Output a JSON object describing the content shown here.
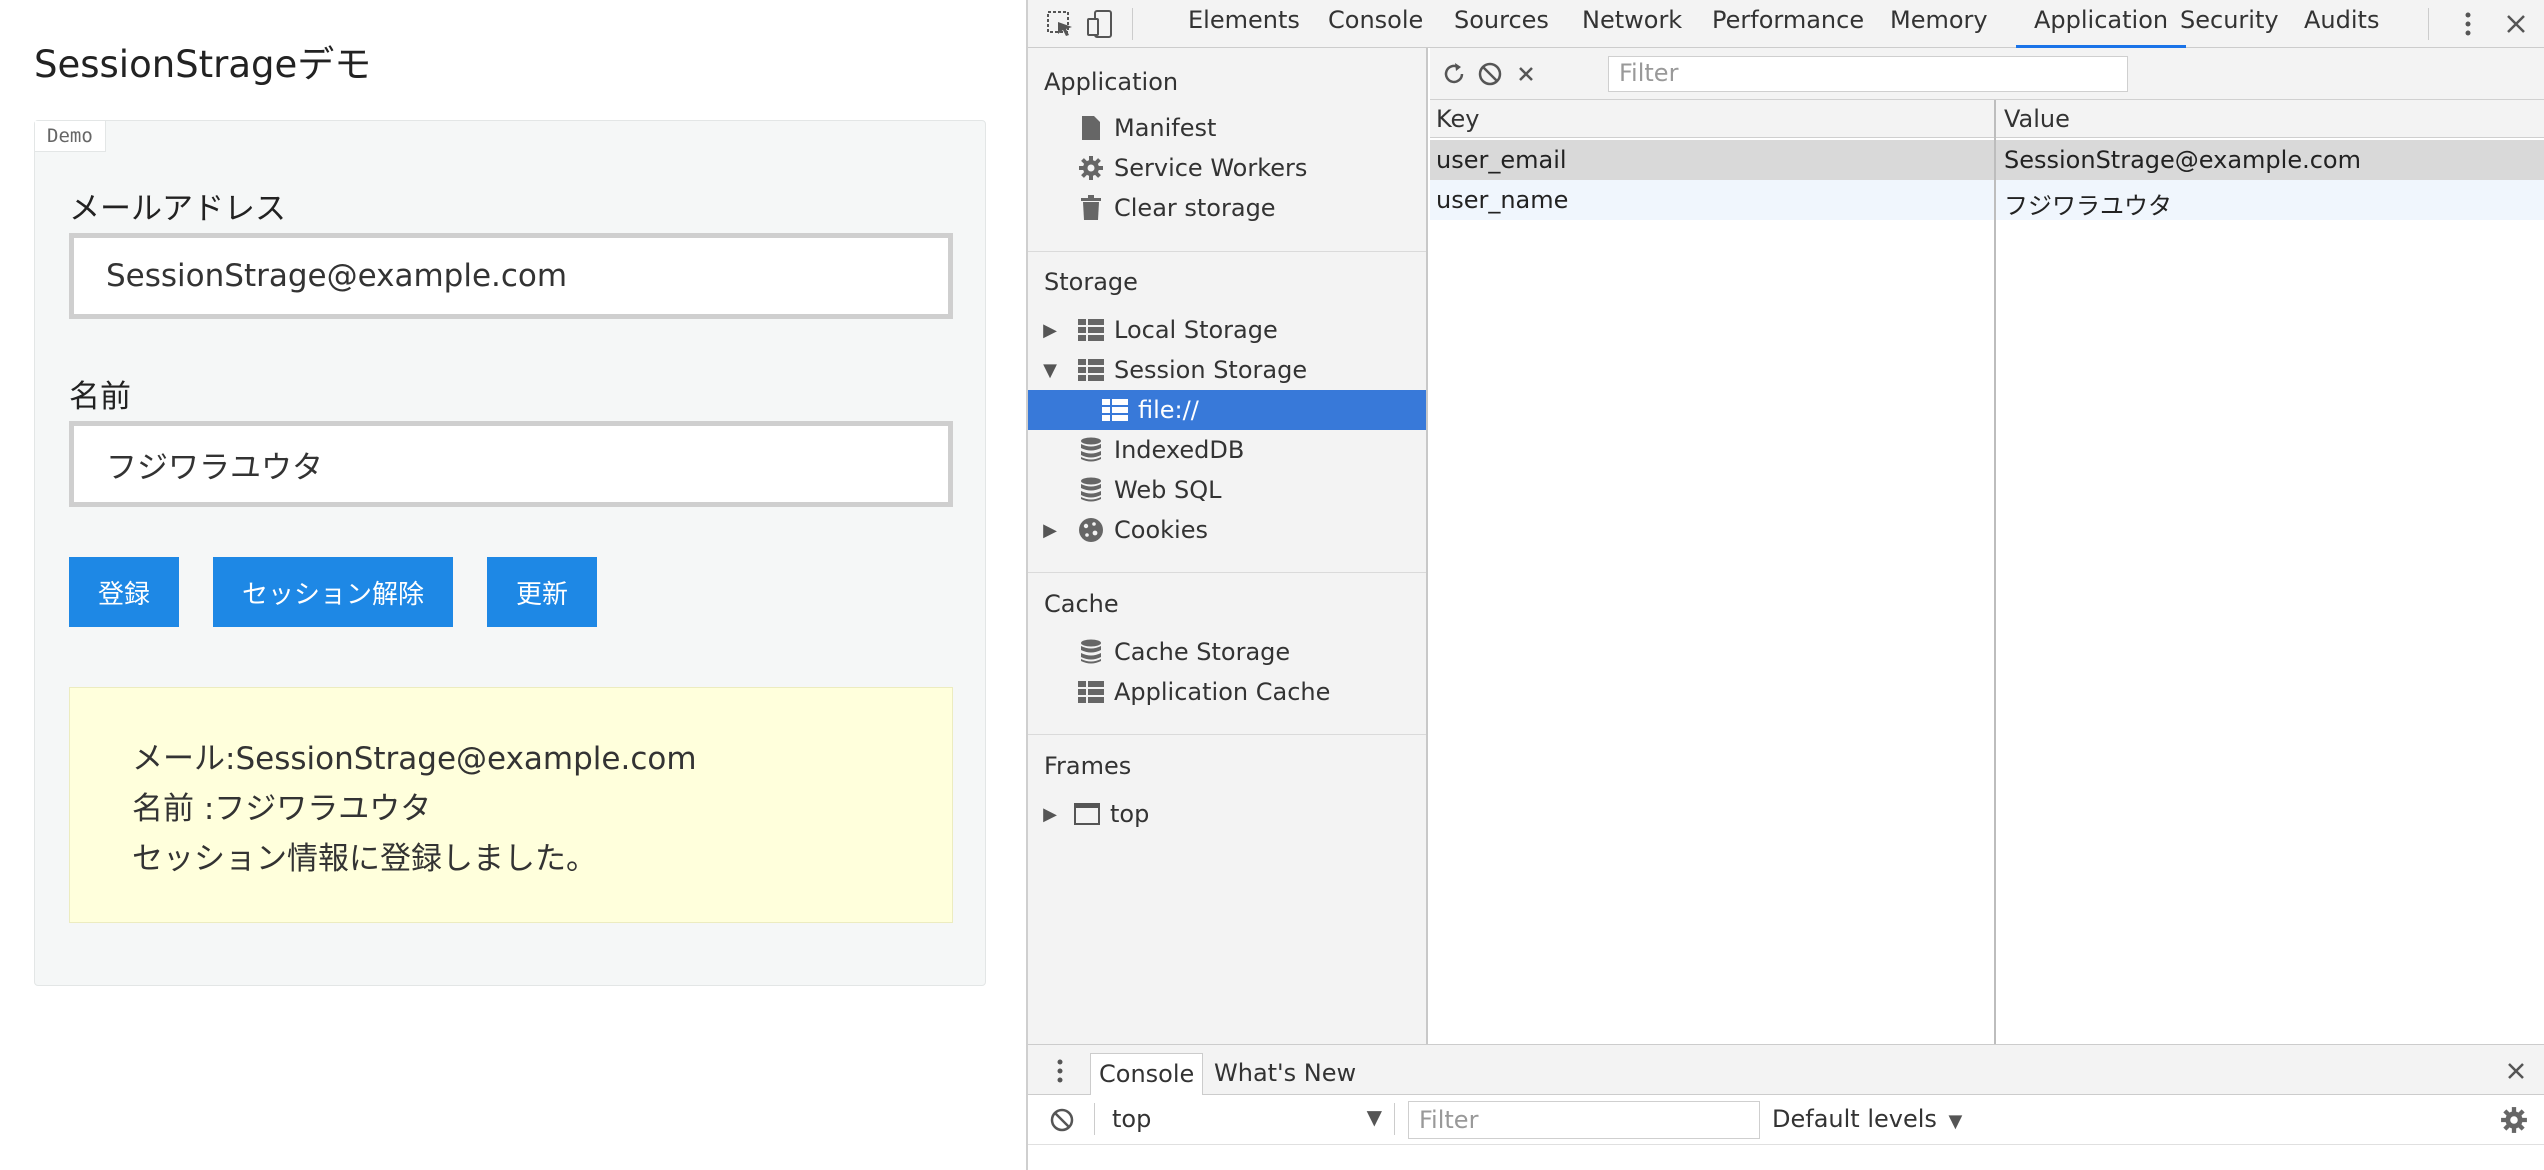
{
  "page": {
    "title": "SessionStrageデモ",
    "demo_tag": "Demo",
    "email_label": "メールアドレス",
    "email_value": "SessionStrage@example.com",
    "name_label": "名前",
    "name_value": "フジワラユウタ",
    "buttons": [
      "登録",
      "セッション解除",
      "更新"
    ],
    "result_lines": [
      "メール:SessionStrage@example.com",
      "名前 :フジワラユウタ",
      "セッション情報に登録しました。"
    ]
  },
  "devtools": {
    "tabs": [
      "Elements",
      "Console",
      "Sources",
      "Network",
      "Performance",
      "Memory",
      "Application",
      "Security",
      "Audits"
    ],
    "active_tab": "Application",
    "sidebar": {
      "application_title": "Application",
      "application_items": [
        "Manifest",
        "Service Workers",
        "Clear storage"
      ],
      "storage_title": "Storage",
      "storage_items": [
        "Local Storage",
        "Session Storage",
        "file://",
        "IndexedDB",
        "Web SQL",
        "Cookies"
      ],
      "cache_title": "Cache",
      "cache_items": [
        "Cache Storage",
        "Application Cache"
      ],
      "frames_title": "Frames",
      "frames_items": [
        "top"
      ]
    },
    "toolbar": {
      "filter_placeholder": "Filter"
    },
    "table": {
      "columns": [
        "Key",
        "Value"
      ],
      "rows": [
        {
          "key": "user_email",
          "value": "SessionStrage@example.com"
        },
        {
          "key": "user_name",
          "value": "フジワラユウタ"
        }
      ]
    },
    "drawer": {
      "tabs": [
        "Console",
        "What's New"
      ],
      "context": "top",
      "filter_placeholder": "Filter",
      "levels": "Default levels"
    },
    "colors": {
      "accent": "#1a73e8",
      "selected": "#3879d9",
      "button": "#1e88e5"
    }
  }
}
